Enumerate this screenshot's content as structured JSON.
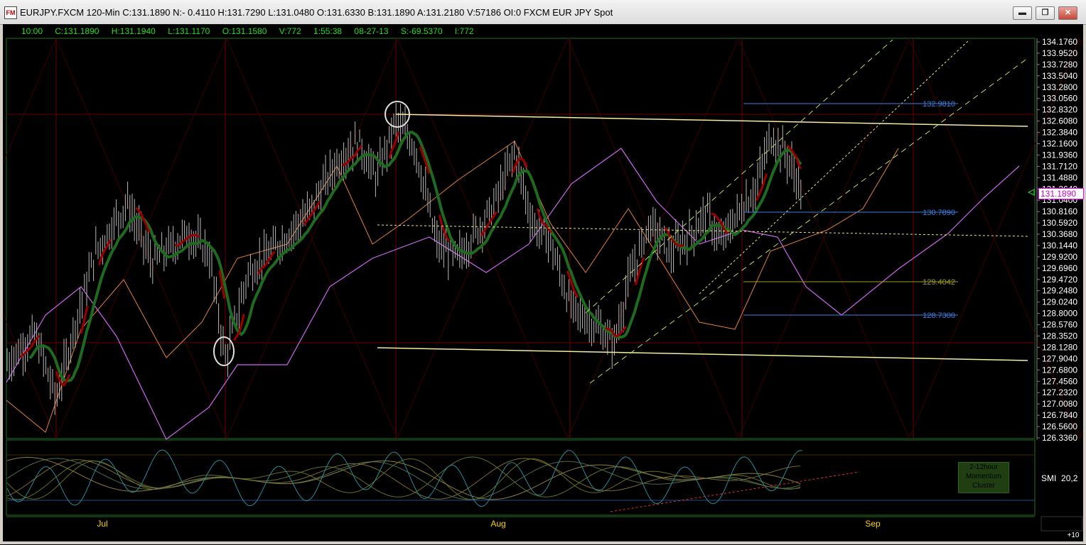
{
  "window": {
    "title": "EURJPY.FXCM 120-Min C:131.1890 N:- 0.4110 H:131.7290 L:131.0480 O:131.6330 B:131.1890 A:131.2180 V:57186 OI:0 FXCM EUR JPY Spot",
    "icon_label": "FM",
    "minimize_glyph": "▬",
    "restore_glyph": "❐",
    "close_glyph": "✕"
  },
  "info_bar": {
    "time": "10:00",
    "close": "C:131.1890",
    "high": "H:131.1940",
    "low": "L:131.1170",
    "open": "O:131.1580",
    "volume": "V:772",
    "elapsed": "1:55:38",
    "date": "08-27-13",
    "s_value": "S:-69.5370",
    "i_value": "I:772"
  },
  "price_axis": {
    "ticks": [
      "134.1760",
      "133.9520",
      "133.7280",
      "133.5040",
      "133.2800",
      "133.0560",
      "132.8320",
      "132.6080",
      "132.3840",
      "132.1600",
      "131.9360",
      "131.7120",
      "131.4880",
      "131.2640",
      "131.0400",
      "130.8160",
      "130.5920",
      "130.3680",
      "130.1440",
      "129.9200",
      "129.6960",
      "129.4720",
      "129.2480",
      "129.0240",
      "128.8000",
      "128.5760",
      "128.3520",
      "128.1280",
      "127.9040",
      "127.6800",
      "127.4560",
      "127.2320",
      "127.0080",
      "126.7840",
      "126.5600",
      "126.3360"
    ],
    "current_price": "131.1890",
    "current_color": "#ff00ff"
  },
  "fib_levels": [
    {
      "label": "132.9810",
      "color": "#3a7fe0"
    },
    {
      "label": "130.7890",
      "color": "#3a7fe0"
    },
    {
      "label": "129.4042",
      "color": "#a09a2a"
    },
    {
      "label": "128.7300",
      "color": "#3a7fe0"
    }
  ],
  "time_axis": {
    "labels": [
      "Jul",
      "Aug",
      "Sep"
    ]
  },
  "indicator": {
    "name": "SMI",
    "params": "20,2",
    "box_lines": [
      "2-12hour",
      "Momentum",
      "Cluster"
    ],
    "scroll_label": "+10"
  },
  "colors": {
    "background": "#000000",
    "grid_red": "#6a0000",
    "bar_gray": "#b8b8b8",
    "ma_green": "#1e6a1e",
    "ma_red": "#9a0000",
    "band_magenta": "#cc66ee",
    "band_orange": "#e0803a",
    "channel_yellow": "#f0f0a0",
    "channel_dash": "#b8e060"
  }
}
